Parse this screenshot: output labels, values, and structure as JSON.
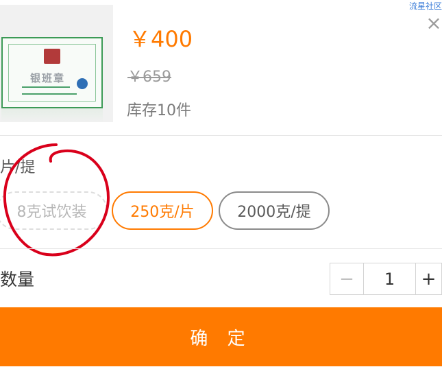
{
  "header": {
    "community_link": "流星社区",
    "close_label": "×"
  },
  "product": {
    "image_label": "银班章",
    "price": "￥400",
    "original_price": "￥659",
    "stock": "库存10件"
  },
  "spec": {
    "label": "片/提",
    "options": [
      {
        "label": "8克试饮装",
        "state": "disabled"
      },
      {
        "label": "250克/片",
        "state": "selected"
      },
      {
        "label": "2000克/提",
        "state": "default"
      }
    ]
  },
  "quantity": {
    "label": "数量",
    "value": "1",
    "minus_label": "−",
    "plus_label": "+"
  },
  "confirm_label": "确 定",
  "colors": {
    "accent": "#ff7a00",
    "annotation": "#d9001b"
  }
}
